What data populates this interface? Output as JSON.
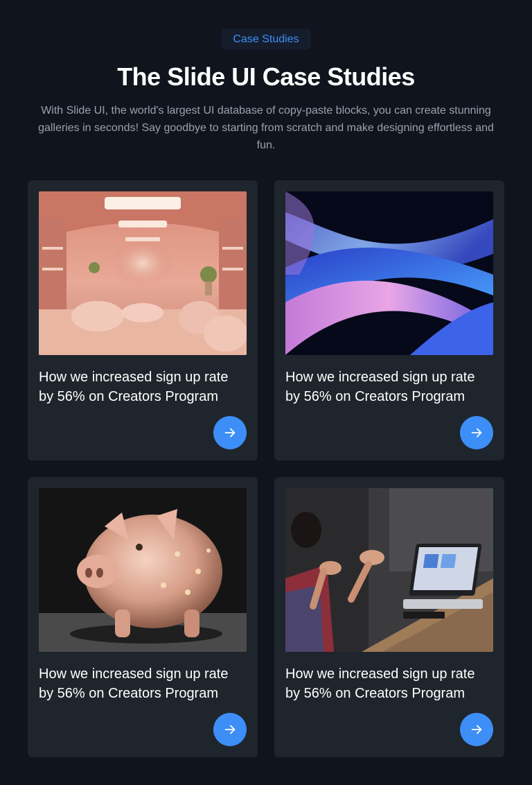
{
  "header": {
    "badge": "Case Studies",
    "title": "The Slide UI Case Studies",
    "subtitle": "With Slide UI, the world's largest UI database of copy-paste blocks, you can create stunning galleries in seconds! Say goodbye to starting from scratch and make designing effortless and fun."
  },
  "cards": [
    {
      "title": "How we increased sign up rate by 56% on Creators Program",
      "image": "pink-store-interior",
      "button_icon": "arrow-right-icon"
    },
    {
      "title": "How we increased sign up rate by 56% on Creators Program",
      "image": "blue-abstract-waves",
      "button_icon": "arrow-right-icon"
    },
    {
      "title": "How we increased sign up rate by 56% on Creators Program",
      "image": "glass-piggy-bank",
      "button_icon": "arrow-right-icon"
    },
    {
      "title": "How we increased sign up rate by 56% on Creators Program",
      "image": "meeting-laptop",
      "button_icon": "arrow-right-icon"
    }
  ],
  "colors": {
    "background": "#0f141d",
    "card": "#1f252c",
    "accent": "#3d8ef7",
    "muted_text": "#9aa2af"
  }
}
